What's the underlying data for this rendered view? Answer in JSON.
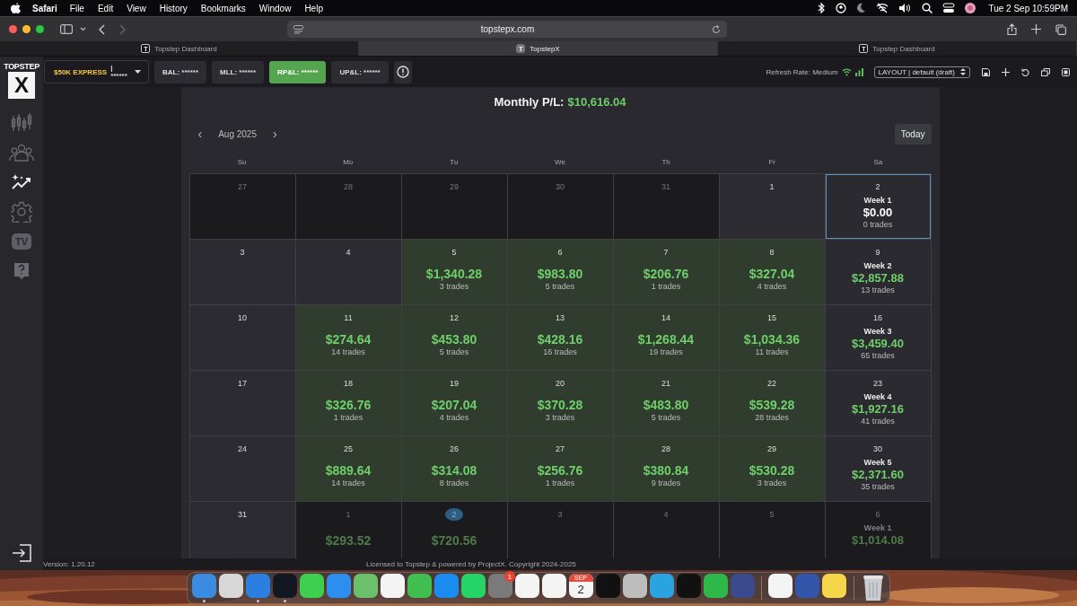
{
  "menu_bar": {
    "app": "Safari",
    "items": [
      "File",
      "Edit",
      "View",
      "History",
      "Bookmarks",
      "Window",
      "Help"
    ],
    "clock": "Tue 2 Sep 10:59PM"
  },
  "browser": {
    "address": "topstepx.com",
    "tabs": [
      {
        "label": "Topstep Dashboard",
        "favicon": "T",
        "selected": false
      },
      {
        "label": "TopstepX",
        "favicon": "T",
        "selected": true
      },
      {
        "label": "Topstep Dashboard",
        "favicon": "T",
        "selected": false
      }
    ]
  },
  "logo": {
    "wordmark": "TOPSTEP",
    "mark": "X"
  },
  "account": {
    "name": "$50K EXPRESS",
    "value": "| ******"
  },
  "metrics": [
    {
      "label": "BAL: ******",
      "selected": false
    },
    {
      "label": "MLL: ******",
      "selected": false
    },
    {
      "label": "RP&L: ******",
      "selected": true
    },
    {
      "label": "UP&L: ******",
      "selected": false
    }
  ],
  "refresh_rate": "Refresh Rate: Medium",
  "layout_select": "LAYOUT | default (draft)",
  "sidebar": [
    {
      "kind": "candles",
      "selected": false
    },
    {
      "kind": "people",
      "selected": false
    },
    {
      "kind": "sparkle",
      "selected": true
    },
    {
      "kind": "gear",
      "selected": false
    },
    {
      "kind": "tv",
      "label": "TV",
      "selected": false
    },
    {
      "kind": "help",
      "selected": false
    }
  ],
  "calendar": {
    "monthly_label": "Monthly P/L:",
    "monthly_value": "$10,616.04",
    "prev": "‹",
    "month": "Aug 2025",
    "next": "›",
    "today_button": "Today",
    "weekdays": [
      "Su",
      "Mo",
      "Tu",
      "We",
      "Th",
      "Fr",
      "Sa"
    ],
    "weeks": [
      {
        "cells": [
          {
            "kind": "day",
            "day": "27",
            "outside": true,
            "selected": false,
            "today": false
          },
          {
            "kind": "day",
            "day": "28",
            "outside": true,
            "selected": false,
            "today": false
          },
          {
            "kind": "day",
            "day": "29",
            "outside": true,
            "selected": false,
            "today": false
          },
          {
            "kind": "day",
            "day": "30",
            "outside": true,
            "selected": false,
            "today": false
          },
          {
            "kind": "day",
            "day": "31",
            "outside": true,
            "selected": false,
            "today": false
          },
          {
            "kind": "day",
            "day": "1",
            "outside": false,
            "selected": false,
            "today": false
          },
          {
            "kind": "week",
            "day": "2",
            "week": "Week 1",
            "amount": "$0.00",
            "trades": "0 trades",
            "outside": false,
            "selected": true,
            "today": false
          }
        ]
      },
      {
        "cells": [
          {
            "kind": "day",
            "day": "3",
            "outside": false,
            "selected": false,
            "today": false
          },
          {
            "kind": "day",
            "day": "4",
            "outside": false,
            "selected": false,
            "today": false
          },
          {
            "kind": "day",
            "day": "5",
            "amount": "$1,340.28",
            "trades": "3 trades",
            "outside": false,
            "selected": false,
            "today": false
          },
          {
            "kind": "day",
            "day": "6",
            "amount": "$983.80",
            "trades": "5 trades",
            "outside": false,
            "selected": false,
            "today": false
          },
          {
            "kind": "day",
            "day": "7",
            "amount": "$206.76",
            "trades": "1 trades",
            "outside": false,
            "selected": false,
            "today": false
          },
          {
            "kind": "day",
            "day": "8",
            "amount": "$327.04",
            "trades": "4 trades",
            "outside": false,
            "selected": false,
            "today": false
          },
          {
            "kind": "week",
            "day": "9",
            "week": "Week 2",
            "amount": "$2,857.88",
            "trades": "13 trades",
            "outside": false,
            "selected": false,
            "today": false
          }
        ]
      },
      {
        "cells": [
          {
            "kind": "day",
            "day": "10",
            "outside": false,
            "selected": false,
            "today": false
          },
          {
            "kind": "day",
            "day": "11",
            "amount": "$274.64",
            "trades": "14 trades",
            "outside": false,
            "selected": false,
            "today": false
          },
          {
            "kind": "day",
            "day": "12",
            "amount": "$453.80",
            "trades": "5 trades",
            "outside": false,
            "selected": false,
            "today": false
          },
          {
            "kind": "day",
            "day": "13",
            "amount": "$428.16",
            "trades": "16 trades",
            "outside": false,
            "selected": false,
            "today": false
          },
          {
            "kind": "day",
            "day": "14",
            "amount": "$1,268.44",
            "trades": "19 trades",
            "outside": false,
            "selected": false,
            "today": false
          },
          {
            "kind": "day",
            "day": "15",
            "amount": "$1,034.36",
            "trades": "11 trades",
            "outside": false,
            "selected": false,
            "today": false
          },
          {
            "kind": "week",
            "day": "16",
            "week": "Week 3",
            "amount": "$3,459.40",
            "trades": "65 trades",
            "outside": false,
            "selected": false,
            "today": false
          }
        ]
      },
      {
        "cells": [
          {
            "kind": "day",
            "day": "17",
            "outside": false,
            "selected": false,
            "today": false
          },
          {
            "kind": "day",
            "day": "18",
            "amount": "$326.76",
            "trades": "1 trades",
            "outside": false,
            "selected": false,
            "today": false
          },
          {
            "kind": "day",
            "day": "19",
            "amount": "$207.04",
            "trades": "4 trades",
            "outside": false,
            "selected": false,
            "today": false
          },
          {
            "kind": "day",
            "day": "20",
            "amount": "$370.28",
            "trades": "3 trades",
            "outside": false,
            "selected": false,
            "today": false
          },
          {
            "kind": "day",
            "day": "21",
            "amount": "$483.80",
            "trades": "5 trades",
            "outside": false,
            "selected": false,
            "today": false
          },
          {
            "kind": "day",
            "day": "22",
            "amount": "$539.28",
            "trades": "28 trades",
            "outside": false,
            "selected": false,
            "today": false
          },
          {
            "kind": "week",
            "day": "23",
            "week": "Week 4",
            "amount": "$1,927.16",
            "trades": "41 trades",
            "outside": false,
            "selected": false,
            "today": false
          }
        ]
      },
      {
        "cells": [
          {
            "kind": "day",
            "day": "24",
            "outside": false,
            "selected": false,
            "today": false
          },
          {
            "kind": "day",
            "day": "25",
            "amount": "$889.64",
            "trades": "14 trades",
            "outside": false,
            "selected": false,
            "today": false
          },
          {
            "kind": "day",
            "day": "26",
            "amount": "$314.08",
            "trades": "8 trades",
            "outside": false,
            "selected": false,
            "today": false
          },
          {
            "kind": "day",
            "day": "27",
            "amount": "$256.76",
            "trades": "1 trades",
            "outside": false,
            "selected": false,
            "today": false
          },
          {
            "kind": "day",
            "day": "28",
            "amount": "$380.84",
            "trades": "9 trades",
            "outside": false,
            "selected": false,
            "today": false
          },
          {
            "kind": "day",
            "day": "29",
            "amount": "$530.28",
            "trades": "3 trades",
            "outside": false,
            "selected": false,
            "today": false
          },
          {
            "kind": "week",
            "day": "30",
            "week": "Week 5",
            "amount": "$2,371.60",
            "trades": "35 trades",
            "outside": false,
            "selected": false,
            "today": false
          }
        ]
      },
      {
        "cells": [
          {
            "kind": "day",
            "day": "31",
            "outside": false,
            "selected": false,
            "today": false
          },
          {
            "kind": "day",
            "day": "1",
            "amount": "$293.52",
            "outside": true,
            "selected": false,
            "today": false
          },
          {
            "kind": "day",
            "day": "2",
            "amount": "$720.56",
            "outside": true,
            "selected": false,
            "today": true
          },
          {
            "kind": "day",
            "day": "3",
            "outside": true,
            "selected": false,
            "today": false
          },
          {
            "kind": "day",
            "day": "4",
            "outside": true,
            "selected": false,
            "today": false
          },
          {
            "kind": "day",
            "day": "5",
            "outside": true,
            "selected": false,
            "today": false
          },
          {
            "kind": "week",
            "day": "6",
            "week": "Week 1",
            "amount": "$1,014.08",
            "outside": true,
            "selected": false,
            "today": false
          }
        ]
      }
    ]
  },
  "footer": {
    "version": "Version: 1.20.12",
    "license": "Licensed to Topstep & powered by ProjectX. Copyright 2024-2025"
  },
  "dock": {
    "apps": [
      {
        "color": "#3b8be0",
        "running": true
      },
      {
        "color": "#d8d8d8",
        "running": false
      },
      {
        "color": "#2a7fe0",
        "running": true
      },
      {
        "color": "#131722",
        "running": true
      },
      {
        "color": "#3fcf4f",
        "running": false
      },
      {
        "color": "#2e8ef0",
        "running": false
      },
      {
        "color": "#6cc06c",
        "running": false
      },
      {
        "color": "#f4f4f4",
        "running": false
      },
      {
        "color": "#3fbf4f",
        "running": false
      },
      {
        "color": "#1a8cf0",
        "running": false
      },
      {
        "color": "#25d366",
        "running": false
      },
      {
        "color": "#7a7a7a",
        "badge": "1",
        "running": false
      },
      {
        "color": "#f4f4f4",
        "running": false
      },
      {
        "color": "#f4f4f4",
        "running": false
      },
      {
        "kind": "calendar",
        "month": "SEP",
        "day": "2",
        "color": "#f4f4f4",
        "running": false
      },
      {
        "color": "#111111",
        "running": false
      },
      {
        "color": "#bdbdbd",
        "running": false
      },
      {
        "color": "#2aa3e0",
        "running": false
      },
      {
        "color": "#111111",
        "running": false
      },
      {
        "color": "#2fb84a",
        "running": false
      },
      {
        "color": "#3a4a8a",
        "running": false
      }
    ],
    "others": [
      {
        "color": "#f4f4f4",
        "running": false
      },
      {
        "color": "#3355aa",
        "running": false
      },
      {
        "color": "#f5d64a",
        "running": false
      }
    ]
  }
}
